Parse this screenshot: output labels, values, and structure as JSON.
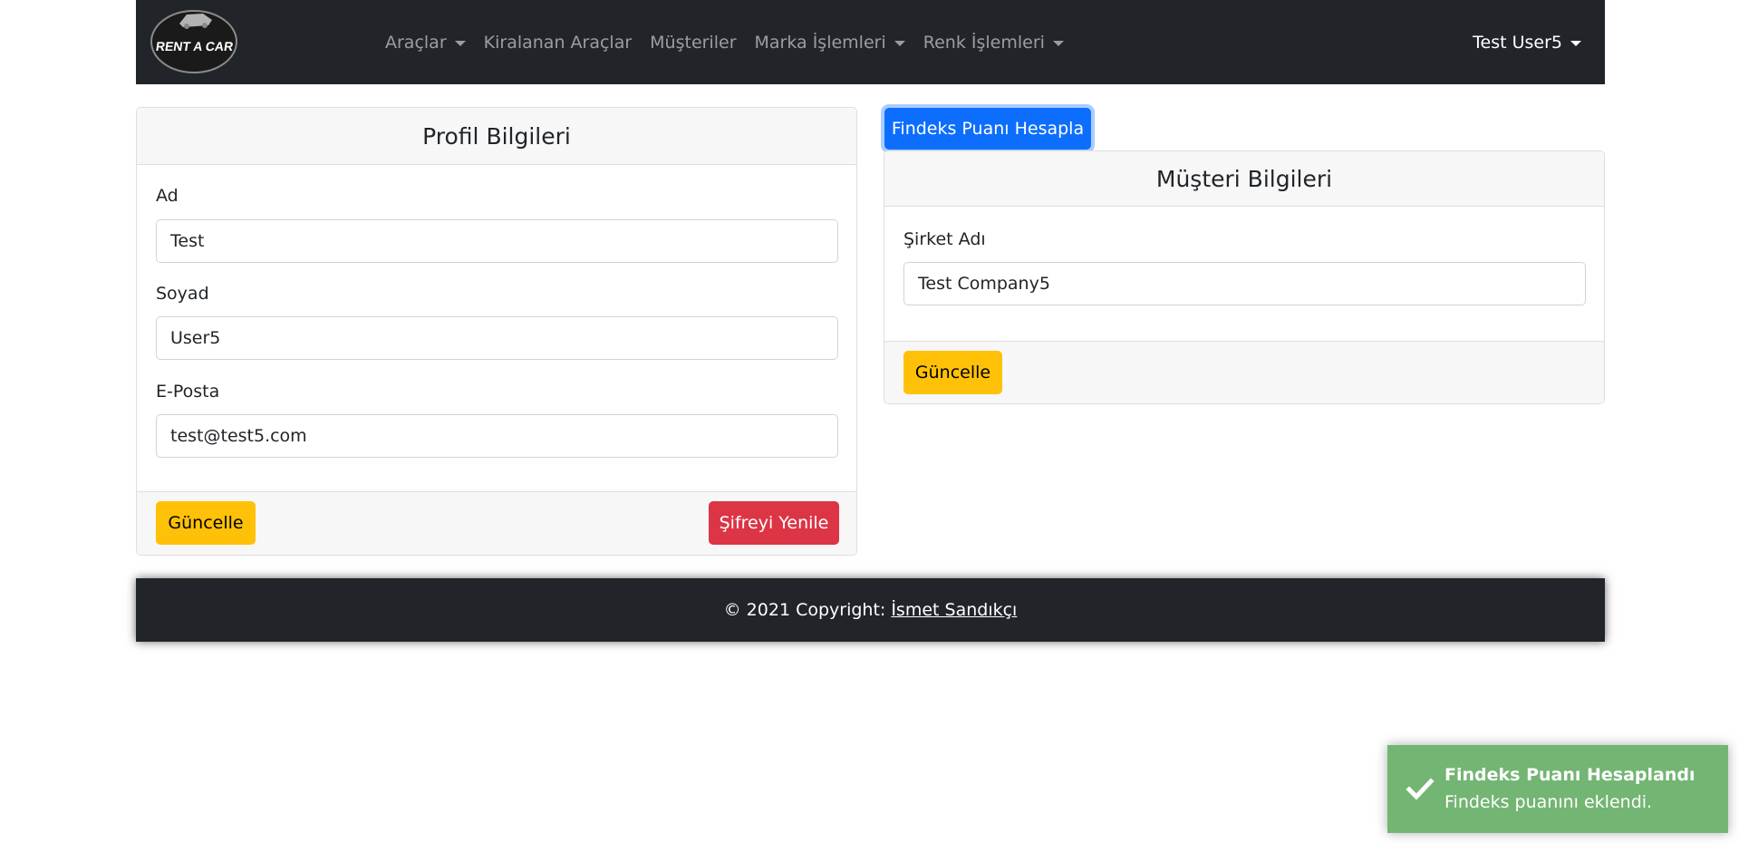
{
  "navbar": {
    "logo_text": "RENT A CAR",
    "items": [
      {
        "label": "Araçlar",
        "dropdown": true
      },
      {
        "label": "Kiralanan Araçlar",
        "dropdown": false
      },
      {
        "label": "Müşteriler",
        "dropdown": false
      },
      {
        "label": "Marka İşlemleri",
        "dropdown": true
      },
      {
        "label": "Renk İşlemleri",
        "dropdown": true
      }
    ],
    "user": "Test User5"
  },
  "profile": {
    "title": "Profil Bilgileri",
    "first_name_label": "Ad",
    "first_name_value": "Test",
    "last_name_label": "Soyad",
    "last_name_value": "User5",
    "email_label": "E-Posta",
    "email_value": "test@test5.com",
    "update_button": "Güncelle",
    "reset_password_button": "Şifreyi Yenile"
  },
  "customer": {
    "findeks_button": "Findeks Puanı Hesapla",
    "title": "Müşteri Bilgileri",
    "company_label": "Şirket Adı",
    "company_value": "Test Company5",
    "update_button": "Güncelle"
  },
  "footer": {
    "copyright": "© 2021 Copyright:",
    "author": "İsmet Sandıkçı"
  },
  "toast": {
    "title": "Findeks Puanı Hesaplandı",
    "message": "Findeks puanını eklendi.",
    "icon": "check-icon"
  },
  "colors": {
    "navbar": "#212529",
    "warning": "#ffc107",
    "danger": "#dc3545",
    "primary": "#0d6efd",
    "toast_success": "#51a351"
  }
}
